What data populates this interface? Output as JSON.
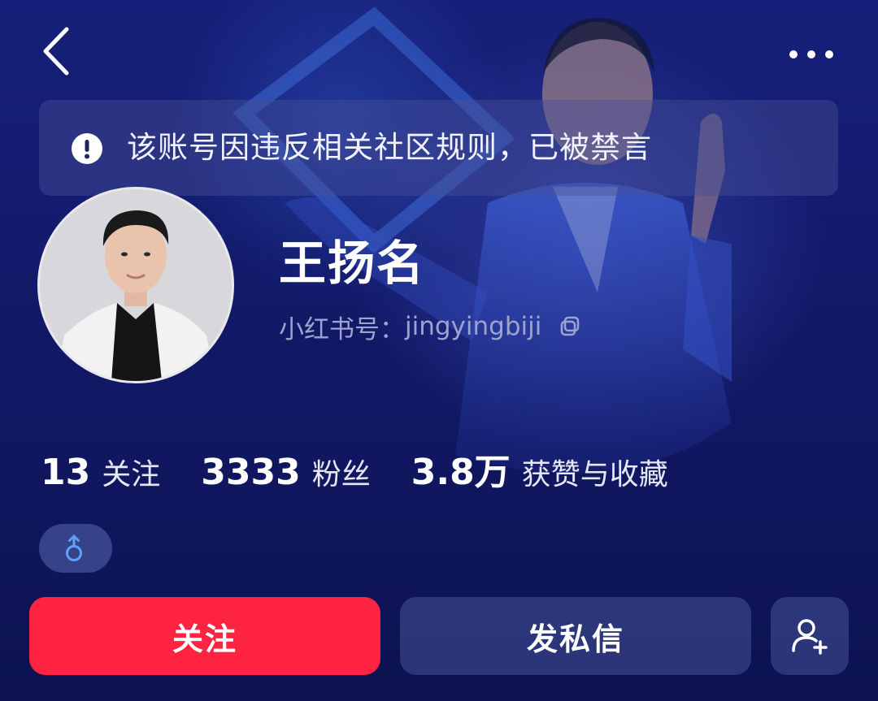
{
  "header": {
    "back_icon": "chevron-left-icon",
    "more_icon": "more-horizontal-icon"
  },
  "notice": {
    "icon": "exclamation-circle-icon",
    "text": "该账号因违反相关社区规则，已被禁言"
  },
  "profile": {
    "nickname": "王扬名",
    "red_id_label": "小红书号：",
    "red_id": "jingyingbiji",
    "copy_icon": "copy-icon",
    "gender_icon": "male-icon",
    "gender_color": "#5aa2ff"
  },
  "stats": [
    {
      "value": "13",
      "label": "关注"
    },
    {
      "value": "3333",
      "label": "粉丝"
    },
    {
      "value": "3.8万",
      "label": "获赞与收藏"
    }
  ],
  "actions": {
    "follow_label": "关注",
    "follow_color": "#ff2442",
    "message_label": "发私信",
    "add_friend_icon": "add-user-icon"
  }
}
